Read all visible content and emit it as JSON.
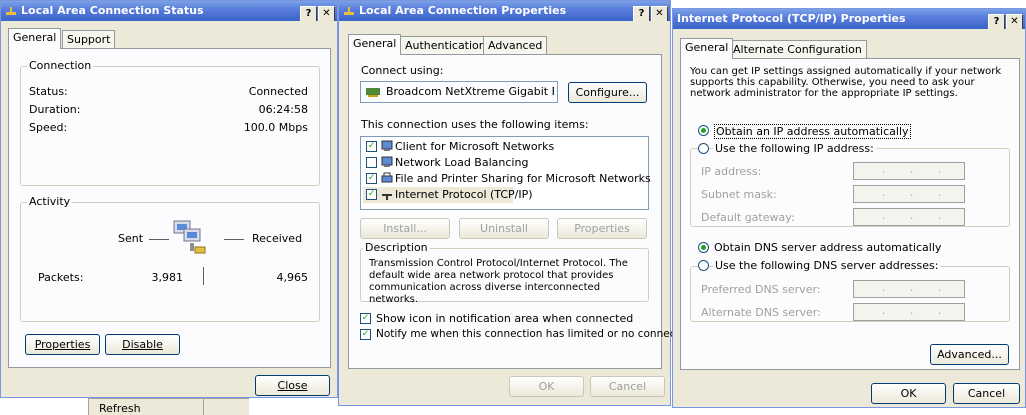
{
  "status_dialog": {
    "title": "Local Area Connection Status",
    "tabs": [
      "General",
      "Support"
    ],
    "connection_group": "Connection",
    "status_label": "Status:",
    "status_value": "Connected",
    "duration_label": "Duration:",
    "duration_value": "06:24:58",
    "speed_label": "Speed:",
    "speed_value": "100.0 Mbps",
    "activity_group": "Activity",
    "sent_label": "Sent",
    "received_label": "Received",
    "packets_label": "Packets:",
    "packets_sent": "3,981",
    "packets_received": "4,965",
    "properties_button": "Properties",
    "disable_button": "Disable",
    "close_button": "Close"
  },
  "properties_dialog": {
    "title": "Local Area Connection Properties",
    "tabs": [
      "General",
      "Authentication",
      "Advanced"
    ],
    "connect_using_label": "Connect using:",
    "adapter_name": "Broadcom NetXtreme Gigabit Etherne",
    "configure_button": "Configure...",
    "items_label": "This connection uses the following items:",
    "items": [
      {
        "label": "Client for Microsoft Networks",
        "checked": true
      },
      {
        "label": "Network Load Balancing",
        "checked": false
      },
      {
        "label": "File and Printer Sharing for Microsoft Networks",
        "checked": true
      },
      {
        "label": "Internet Protocol (TCP/IP)",
        "checked": true
      }
    ],
    "install_button": "Install...",
    "uninstall_button": "Uninstall",
    "properties_button": "Properties",
    "description_group": "Description",
    "description_text": "Transmission Control Protocol/Internet Protocol. The default wide area network protocol that provides communication across diverse interconnected networks.",
    "show_icon_label": "Show icon in notification area when connected",
    "notify_label": "Notify me when this connection has limited or no connectivity",
    "ok_button": "OK",
    "cancel_button": "Cancel"
  },
  "tcpip_dialog": {
    "title": "Internet Protocol (TCP/IP) Properties",
    "tabs": [
      "General",
      "Alternate Configuration"
    ],
    "intro_text": "You can get IP settings assigned automatically if your network supports this capability. Otherwise, you need to ask your network administrator for the appropriate IP settings.",
    "obtain_ip_auto": "Obtain an IP address automatically",
    "use_following_ip": "Use the following IP address:",
    "ip_address_label": "IP address:",
    "subnet_mask_label": "Subnet mask:",
    "default_gateway_label": "Default gateway:",
    "obtain_dns_auto": "Obtain DNS server address automatically",
    "use_following_dns": "Use the following DNS server addresses:",
    "preferred_dns_label": "Preferred DNS server:",
    "alternate_dns_label": "Alternate DNS server:",
    "advanced_button": "Advanced...",
    "ok_button": "OK",
    "cancel_button": "Cancel"
  },
  "background": {
    "refresh_menu_item": "Refresh"
  },
  "colors": {
    "titlebar": "#3a63c9",
    "dialog_bg": "#ece9d8",
    "check_green": "#21a121"
  }
}
